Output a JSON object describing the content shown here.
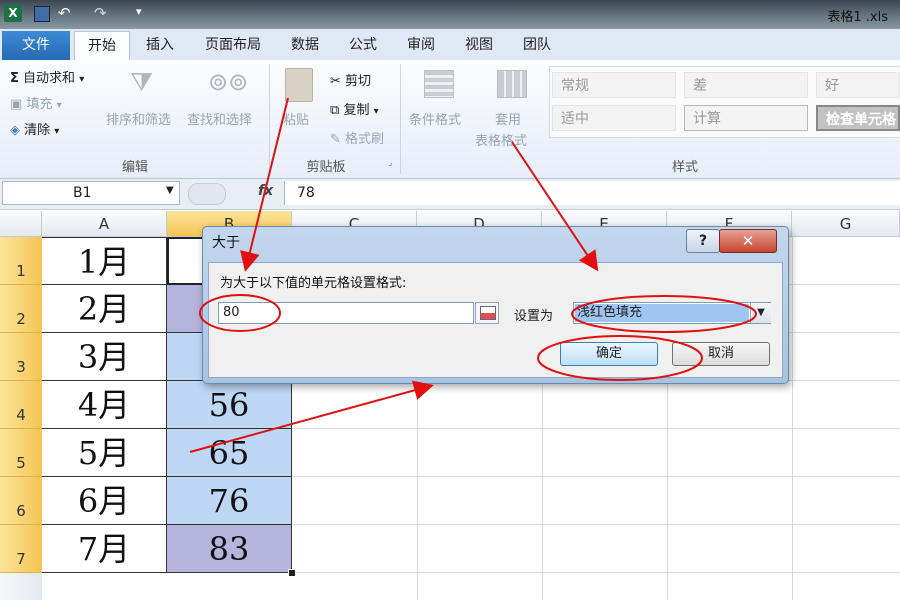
{
  "window": {
    "title": "表格1 .xls",
    "quick_access": [
      "save-icon",
      "undo-icon",
      "redo-icon",
      "customize-icon"
    ]
  },
  "tabs": {
    "file": "文件",
    "items": [
      "开始",
      "插入",
      "页面布局",
      "数据",
      "公式",
      "审阅",
      "视图",
      "团队"
    ],
    "active": "开始"
  },
  "ribbon": {
    "editing": {
      "autosum": "自动求和",
      "fill": "填充",
      "clear": "清除",
      "sort_filter": "排序和筛选",
      "find_select": "查找和选择",
      "group_label": "编辑"
    },
    "clipboard": {
      "paste": "粘贴",
      "cut": "剪切",
      "copy": "复制",
      "format_painter": "格式刷",
      "group_label": "剪贴板"
    },
    "styles": {
      "conditional_format": "条件格式",
      "apply_table": "套用",
      "table_format": "表格格式",
      "cells": [
        "常规",
        "差",
        "好",
        "适中",
        "计算",
        "检查单元格"
      ],
      "group_label": "样式"
    }
  },
  "formula_bar": {
    "name_box": "B1",
    "fx": "fx",
    "value": "78"
  },
  "sheet": {
    "columns": [
      "A",
      "B",
      "C",
      "D",
      "E",
      "F",
      "G"
    ],
    "rows": [
      "1",
      "2",
      "3",
      "4",
      "5",
      "6",
      "7"
    ],
    "col_a": [
      "1月",
      "2月",
      "3月",
      "4月",
      "5月",
      "6月",
      "7月"
    ],
    "col_b": [
      "",
      "",
      "",
      "56",
      "65",
      "76",
      "83"
    ],
    "colors": {
      "blue_fill": "#bdd7f5",
      "purple_fill": "#b4b4dc",
      "selected_header": "#f5c452"
    }
  },
  "dialog": {
    "title": "大于",
    "help": "?",
    "close": "✕",
    "prompt": "为大于以下值的单元格设置格式:",
    "value": "80",
    "set_to_label": "设置为",
    "format_option": "浅红色填充",
    "ok": "确定",
    "cancel": "取消"
  },
  "annotations": {
    "color": "#e01010"
  }
}
